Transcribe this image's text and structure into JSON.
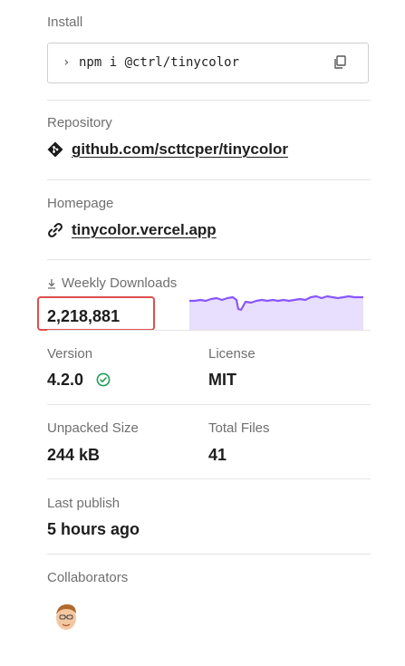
{
  "install": {
    "label": "Install",
    "prompt": "›",
    "command": "npm i @ctrl/tinycolor",
    "copy_icon": "copy-icon"
  },
  "repository": {
    "label": "Repository",
    "icon": "git-icon",
    "link_text": "github.com/scttcper/tinycolor"
  },
  "homepage": {
    "label": "Homepage",
    "icon": "link-icon",
    "link_text": "tinycolor.vercel.app"
  },
  "downloads": {
    "label": "Weekly Downloads",
    "icon": "download-arrow-icon",
    "value": "2,218,881",
    "sparkline_color": "#8956ff",
    "sparkline_fill": "#e8defd",
    "highlight_color": "#e04e4e"
  },
  "version": {
    "label": "Version",
    "value": "4.2.0",
    "verified_icon": "check-circle-icon"
  },
  "license": {
    "label": "License",
    "value": "MIT"
  },
  "unpacked_size": {
    "label": "Unpacked Size",
    "value": "244 kB"
  },
  "total_files": {
    "label": "Total Files",
    "value": "41"
  },
  "last_publish": {
    "label": "Last publish",
    "value": "5 hours ago"
  },
  "collaborators": {
    "label": "Collaborators",
    "avatar_icon": "avatar-icon"
  }
}
